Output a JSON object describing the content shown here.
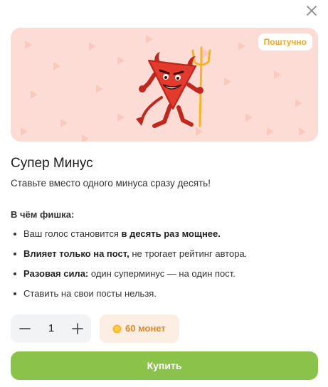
{
  "dialog": {
    "close_icon": "close-icon"
  },
  "banner": {
    "badge": "Поштучно",
    "background_color": "#fcdcd5",
    "image": "devil-minus-mascot"
  },
  "product": {
    "title": "Супер Минус",
    "subtitle": "Ставьте вместо одного минуса сразу десять!"
  },
  "features": {
    "title": "В чём фишка:",
    "items": [
      {
        "bold_prefix": "",
        "text": "Ваш голос становится ",
        "bold_suffix": "в десять раз мощнее."
      },
      {
        "bold_prefix": "Влияет только на пост,",
        "text": " не трогает рейтинг автора.",
        "bold_suffix": ""
      },
      {
        "bold_prefix": "Разовая сила:",
        "text": " один суперминус — на один пост.",
        "bold_suffix": ""
      },
      {
        "bold_prefix": "",
        "text": "Ставить на свои посты нельзя.",
        "bold_suffix": ""
      }
    ]
  },
  "purchase": {
    "quantity": "1",
    "price_label": "60 монет",
    "coin_icon": "coin-icon",
    "minus_icon": "minus-icon",
    "plus_icon": "plus-icon",
    "buy_label": "Купить",
    "accent_color": "#8bc34a",
    "price_color": "#e0862a"
  }
}
